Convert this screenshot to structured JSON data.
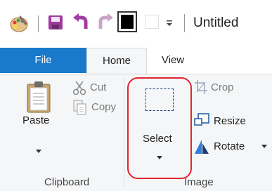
{
  "window": {
    "title": "Untitled"
  },
  "tabs": [
    {
      "label": "File"
    },
    {
      "label": "Home"
    },
    {
      "label": "View"
    }
  ],
  "clipboard": {
    "paste_label": "Paste",
    "cut_label": "Cut",
    "copy_label": "Copy",
    "group_label": "Clipboard"
  },
  "image": {
    "select_label": "Select",
    "crop_label": "Crop",
    "resize_label": "Resize",
    "rotate_label": "Rotate",
    "group_label": "Image"
  },
  "colors": {
    "file_tab": "#1979ca",
    "ribbon_bg": "#f5f6f7",
    "highlight": "#e0252b"
  },
  "icons": [
    "paint-app-icon",
    "save-icon",
    "undo-icon",
    "redo-icon",
    "color-swatch-icon",
    "customize-qat-icon",
    "paste-icon",
    "cut-icon",
    "copy-icon",
    "select-icon",
    "crop-icon",
    "resize-icon",
    "rotate-icon"
  ]
}
